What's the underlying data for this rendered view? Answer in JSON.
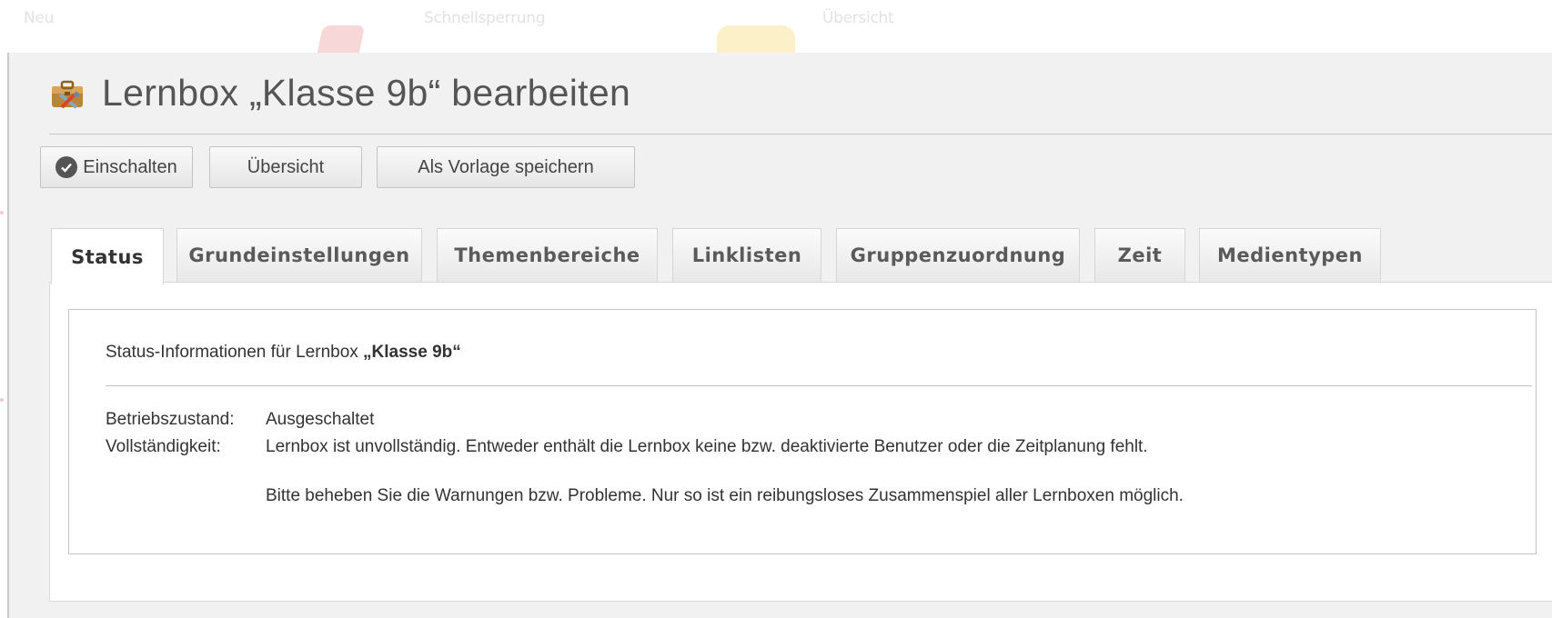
{
  "background_toolbar": {
    "items": [
      "Neu",
      "Schnellsperrung",
      "Übersicht"
    ]
  },
  "header": {
    "title": "Lernbox „Klasse 9b“ bearbeiten",
    "icon": "toolbox-icon"
  },
  "toolbar": {
    "enable_label": "Einschalten",
    "overview_label": "Übersicht",
    "save_template_label": "Als Vorlage speichern"
  },
  "tabs": [
    {
      "label": "Status",
      "active": true
    },
    {
      "label": "Grundeinstellungen",
      "active": false
    },
    {
      "label": "Themenbereiche",
      "active": false
    },
    {
      "label": "Linklisten",
      "active": false
    },
    {
      "label": "Gruppenzuordnung",
      "active": false
    },
    {
      "label": "Zeit",
      "active": false
    },
    {
      "label": "Medientypen",
      "active": false
    }
  ],
  "status": {
    "heading_prefix": "Status-Informationen für Lernbox ",
    "heading_name": "„Klasse 9b“",
    "rows": [
      {
        "label": "Betriebszustand:",
        "value": "Ausgeschaltet"
      },
      {
        "label": "Vollständigkeit:",
        "value": "Lernbox ist unvollständig. Entweder enthält die Lernbox keine bzw. deaktivierte Benutzer oder die Zeitplanung fehlt."
      }
    ],
    "note": "Bitte beheben Sie die Warnungen bzw. Probleme. Nur so ist ein reibungsloses Zusammenspiel aller Lernboxen möglich."
  },
  "colors": {
    "panel_bg": "#f1f1f1",
    "content_bg": "#ffffff",
    "text": "#333333"
  }
}
